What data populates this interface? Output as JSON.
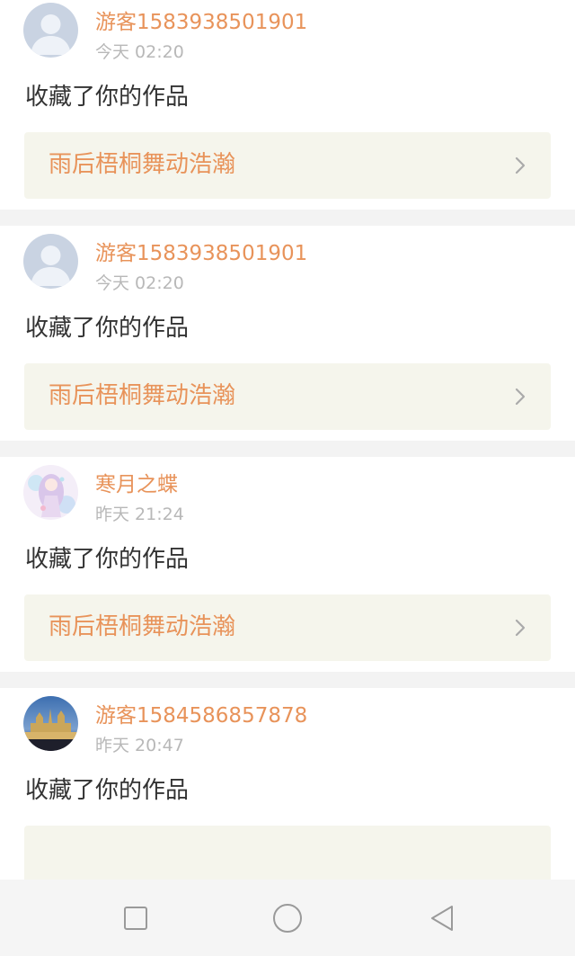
{
  "notifications": [
    {
      "user": "游客1583938501901",
      "time": "今天 02:20",
      "action": "收藏了你的作品",
      "work_title": "雨后梧桐舞动浩瀚",
      "avatar": "default-avatar-icon"
    },
    {
      "user": "游客1583938501901",
      "time": "今天 02:20",
      "action": "收藏了你的作品",
      "work_title": "雨后梧桐舞动浩瀚",
      "avatar": "default-avatar-icon"
    },
    {
      "user": "寒月之蝶",
      "time": "昨天 21:24",
      "action": "收藏了你的作品",
      "work_title": "雨后梧桐舞动浩瀚",
      "avatar": "anime-girl-avatar"
    },
    {
      "user": "游客1584586857878",
      "time": "昨天 20:47",
      "action": "收藏了你的作品",
      "work_title": "",
      "avatar": "castle-photo-avatar"
    }
  ],
  "navbar": {
    "buttons": [
      "recent-apps-icon",
      "home-icon",
      "back-icon"
    ]
  },
  "colors": {
    "accent": "#e8935a",
    "work_bg": "#f5f5ec",
    "divider": "#f3f3f3"
  }
}
